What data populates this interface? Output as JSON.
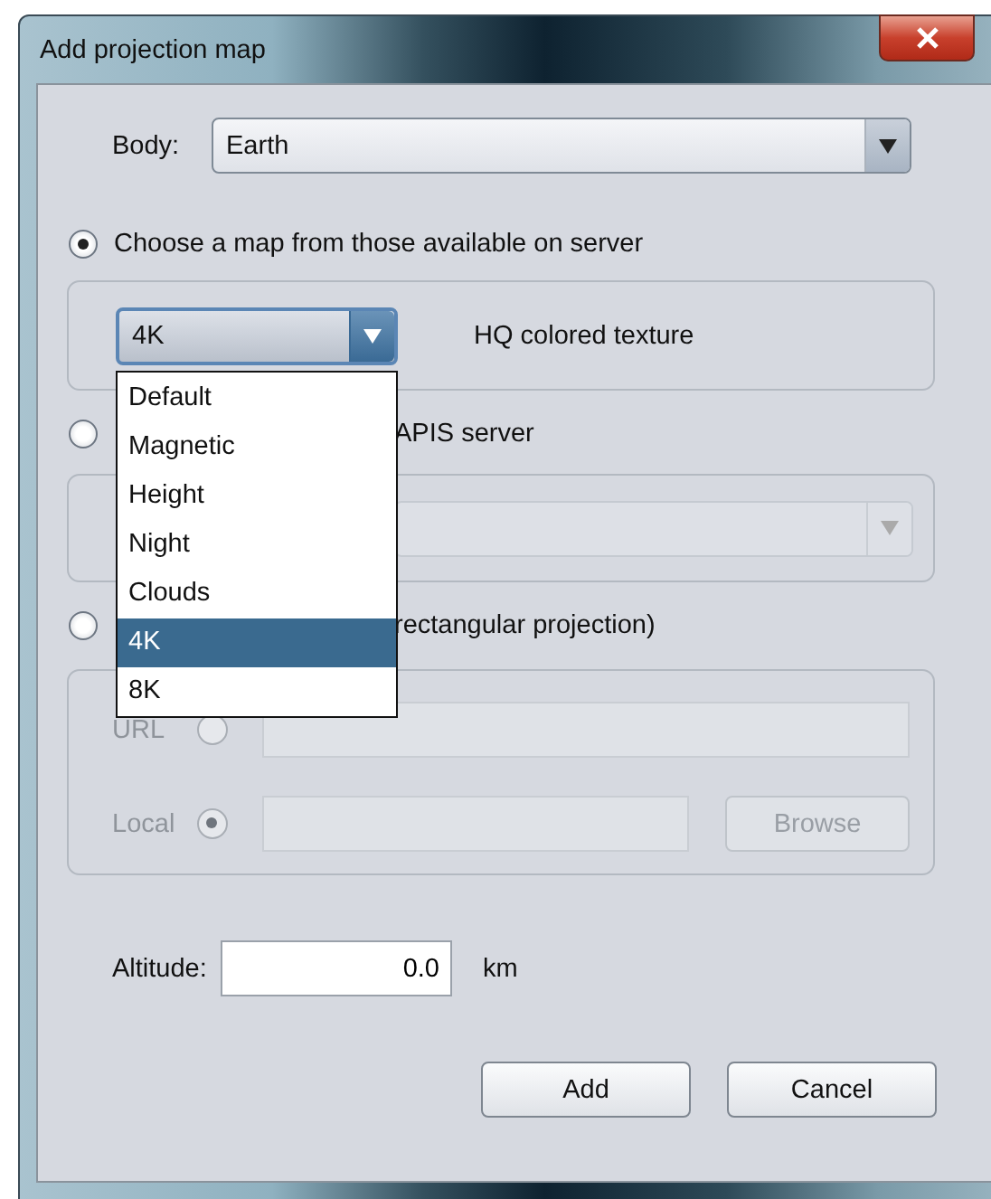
{
  "window": {
    "title": "Add projection map"
  },
  "body": {
    "label": "Body:",
    "value": "Earth"
  },
  "sources": [
    {
      "kind": "server",
      "label": "Choose a map from those available on server",
      "selected": true,
      "map": {
        "value": "4K",
        "description": "HQ colored texture"
      }
    },
    {
      "kind": "wms",
      "label": "APIS server",
      "selected": false
    },
    {
      "kind": "file",
      "label": "rectangular projection)",
      "selected": false,
      "url": {
        "label": "URL",
        "selected": false
      },
      "local": {
        "label": "Local",
        "selected": true
      },
      "browse": "Browse"
    }
  ],
  "dropdown": {
    "items": [
      {
        "label": "Default",
        "selected": false
      },
      {
        "label": "Magnetic",
        "selected": false
      },
      {
        "label": "Height",
        "selected": false
      },
      {
        "label": "Night",
        "selected": false
      },
      {
        "label": "Clouds",
        "selected": false
      },
      {
        "label": "4K",
        "selected": true
      },
      {
        "label": "8K",
        "selected": false
      }
    ]
  },
  "altitude": {
    "label": "Altitude:",
    "value": "0.0",
    "unit": "km"
  },
  "buttons": [
    "Add",
    "Cancel"
  ]
}
